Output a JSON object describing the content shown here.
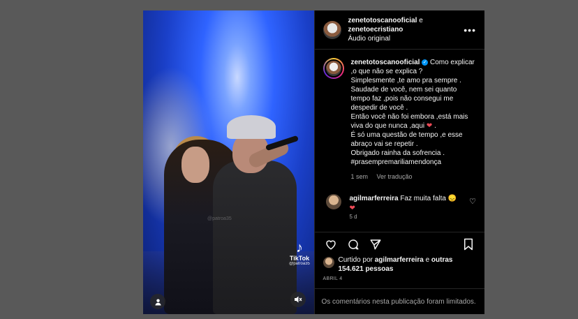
{
  "header": {
    "user1": "zenetotoscanooficial",
    "conj": "e",
    "user2": "zenetoecristiano",
    "audio": "Áudio original"
  },
  "caption": {
    "username": "zenetotoscanooficial",
    "lines": [
      "Como explicar ,o que não se explica ?",
      "Simplesmente ,te amo pra sempre .",
      "Saudade de você, nem sei quanto tempo faz ,pois não consegui me despedir de você .",
      "Então você não foi embora ,está mais viva do que nunca ,aqui",
      "É só uma questão de tempo ,e esse abraço vai se repetir .",
      "Obrigado rainha da sofrencia .",
      "#prasempremariliamendonça"
    ],
    "time": "1 sem",
    "translate": "Ver tradução"
  },
  "comment": {
    "username": "agilmarferreira",
    "text": "Faz muita falta",
    "emoji": "😞",
    "heart": "❤",
    "time": "5 d"
  },
  "likes": {
    "prefix": "Curtido por",
    "user": "agilmarferreira",
    "suffix": "e",
    "others": "outras 154.621",
    "others2": "pessoas"
  },
  "date": "ABRIL 4",
  "limited": "Os comentários nesta publicação foram limitados.",
  "video": {
    "tiktok_label": "TikTok",
    "tiktok_user": "@patroa35",
    "watermark": "@patroa35"
  },
  "icons": {
    "more": "more-icon",
    "verified": "verified-icon",
    "heart_red": "#ed4956",
    "like": "heart-outline-icon",
    "comment": "comment-icon",
    "share": "share-icon",
    "save": "bookmark-icon",
    "mute": "muted-speaker-icon",
    "user_tag": "user-tag-icon"
  }
}
